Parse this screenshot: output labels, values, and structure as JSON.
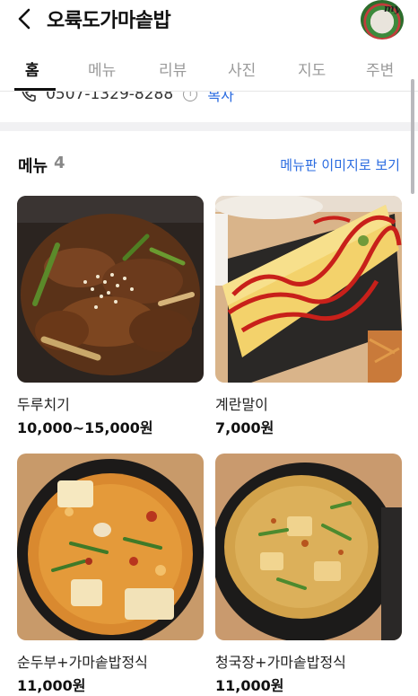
{
  "header": {
    "title": "오륙도가마솥밥",
    "avatar_badge": "my"
  },
  "tabs": [
    {
      "label": "홈",
      "active": true
    },
    {
      "label": "메뉴",
      "active": false
    },
    {
      "label": "리뷰",
      "active": false
    },
    {
      "label": "사진",
      "active": false
    },
    {
      "label": "지도",
      "active": false
    },
    {
      "label": "주변",
      "active": false
    }
  ],
  "contact": {
    "phone": "0507-1329-8288",
    "copy_label": "복사"
  },
  "menu": {
    "label": "메뉴",
    "count": "4",
    "board_link": "메뉴판 이미지로 보기",
    "items": [
      {
        "name": "두루치기",
        "price": "10,000~15,000원",
        "photo": "spicy-stir-fried-pork"
      },
      {
        "name": "계란말이",
        "price": "7,000원",
        "photo": "rolled-omelette-with-ketchup"
      },
      {
        "name": "순두부+가마솥밥정식",
        "price": "11,000원",
        "photo": "soft-tofu-stew"
      },
      {
        "name": "청국장+가마솥밥정식",
        "price": "11,000원",
        "photo": "fermented-soybean-stew"
      }
    ]
  },
  "colors": {
    "accent": "#2a6be0",
    "text": "#111111",
    "muted": "#9a9a9a",
    "section_gap": "#f1f1f3"
  }
}
